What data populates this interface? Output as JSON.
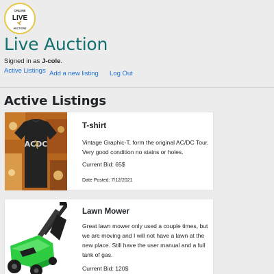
{
  "logo": {
    "line1": "ONLINE",
    "line2": "LIVE",
    "line3": "AUCTIONS"
  },
  "site_title": "Live Auction",
  "user": {
    "signed_prefix": "Signed in as ",
    "username": "J-cole",
    "suffix": "."
  },
  "nav": {
    "active_listings": "Active Listings",
    "add_listing": "Add a new listing",
    "logout": "Log Out"
  },
  "section_title": "Active Listings",
  "listings": [
    {
      "title": "T-shirt",
      "description": "Vintage Graphic-T, form the original AC/DC Tour. Very good condition no stains or holes.",
      "bid_label": "Current Bid: 65$",
      "date_label": "Date Posted: 7/12/2021",
      "image_icon": "acdc-tshirt-photo"
    },
    {
      "title": "Lawn Mower",
      "description": "Great lawn mower only used a couple times, but we are moving and I will not have a lawn at the new place. Still have the user manual and a full tank of gas.",
      "bid_label": "Current Bid: 120$",
      "image_icon": "lawn-mower-photo"
    }
  ],
  "colors": {
    "title_teal": "#14706e",
    "link_blue": "#1b6fd1",
    "background": "#ececec",
    "logo_border": "#e6c94a"
  }
}
